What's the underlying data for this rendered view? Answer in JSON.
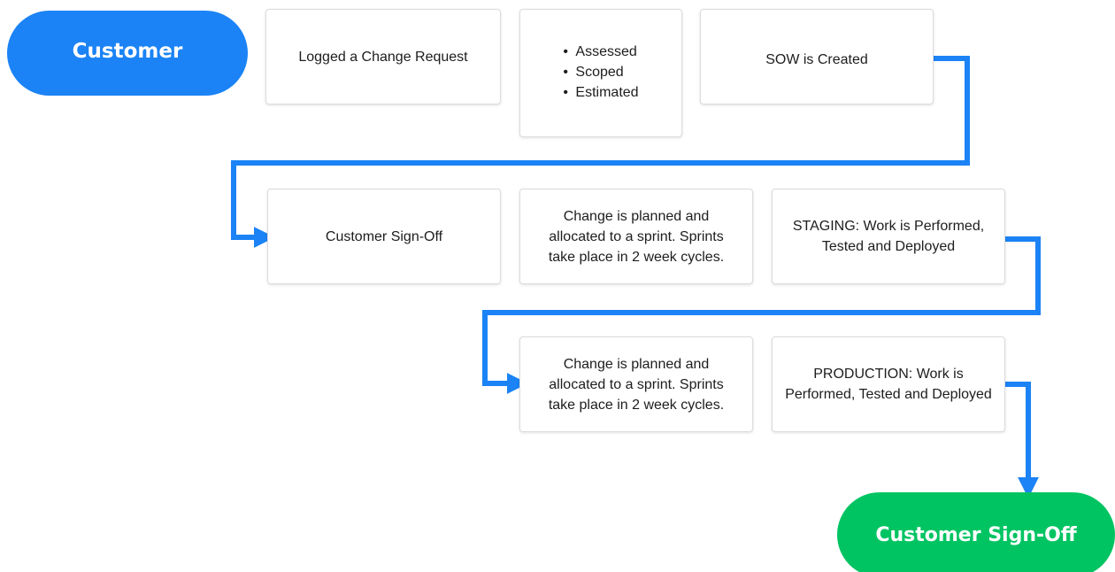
{
  "start_node": {
    "label": "Customer"
  },
  "end_node": {
    "label": "Customer Sign-Off"
  },
  "row1": {
    "logged": "Logged a Change Request",
    "assessment_items": [
      "Assessed",
      "Scoped",
      "Estimated"
    ],
    "sow": "SOW is Created"
  },
  "row2": {
    "signoff": "Customer Sign-Off",
    "planned": "Change is planned and allocated to a sprint. Sprints take place in 2 week cycles.",
    "staging": "STAGING: Work is Performed, Tested and Deployed"
  },
  "row3": {
    "planned": "Change is planned and allocated to a sprint. Sprints take place in 2 week cycles.",
    "production": "PRODUCTION: Work is Performed, Tested and Deployed"
  },
  "colors": {
    "start": "#1b83f5",
    "end": "#00c462",
    "connector": "#1b83f5"
  }
}
